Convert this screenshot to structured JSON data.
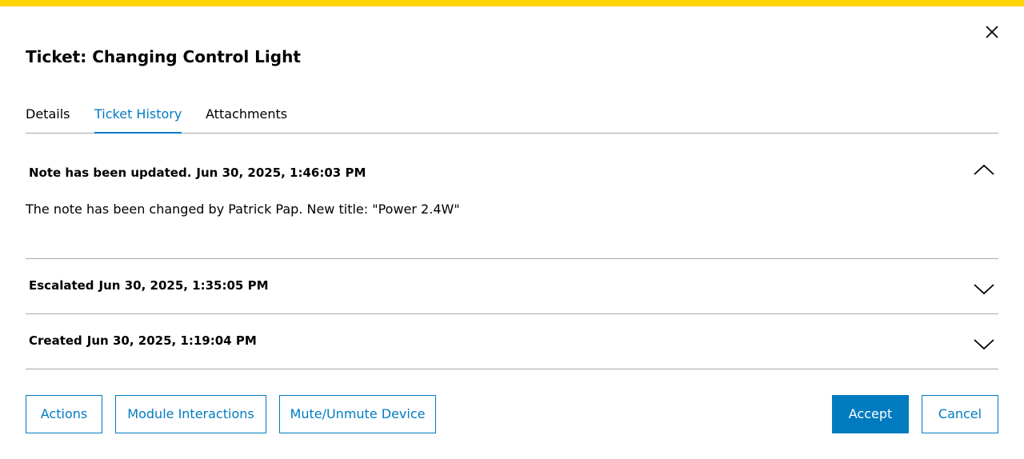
{
  "colors": {
    "accent": "#007bc0",
    "top_bar": "#ffd400",
    "divider": "#a4abb3"
  },
  "dialog": {
    "title": "Ticket: Changing Control Light",
    "close_icon": "close-icon"
  },
  "tabs": [
    {
      "label": "Details",
      "active": false
    },
    {
      "label": "Ticket History",
      "active": true
    },
    {
      "label": "Attachments",
      "active": false
    }
  ],
  "history": [
    {
      "event": "Note has been updated.",
      "timestamp": "Jun 30, 2025, 1:46:03 PM",
      "expanded": true,
      "icon": "chevron-up-icon",
      "body": "The note has been changed by Patrick Pap. New title: \"Power 2.4W\""
    },
    {
      "event": "Escalated",
      "timestamp": "Jun 30, 2025, 1:35:05 PM",
      "expanded": false,
      "icon": "chevron-down-icon"
    },
    {
      "event": "Created",
      "timestamp": "Jun 30, 2025, 1:19:04 PM",
      "expanded": false,
      "icon": "chevron-down-icon"
    }
  ],
  "footer": {
    "actions_label": "Actions",
    "module_interactions_label": "Module Interactions",
    "mute_label": "Mute/Unmute Device",
    "accept_label": "Accept",
    "cancel_label": "Cancel"
  }
}
